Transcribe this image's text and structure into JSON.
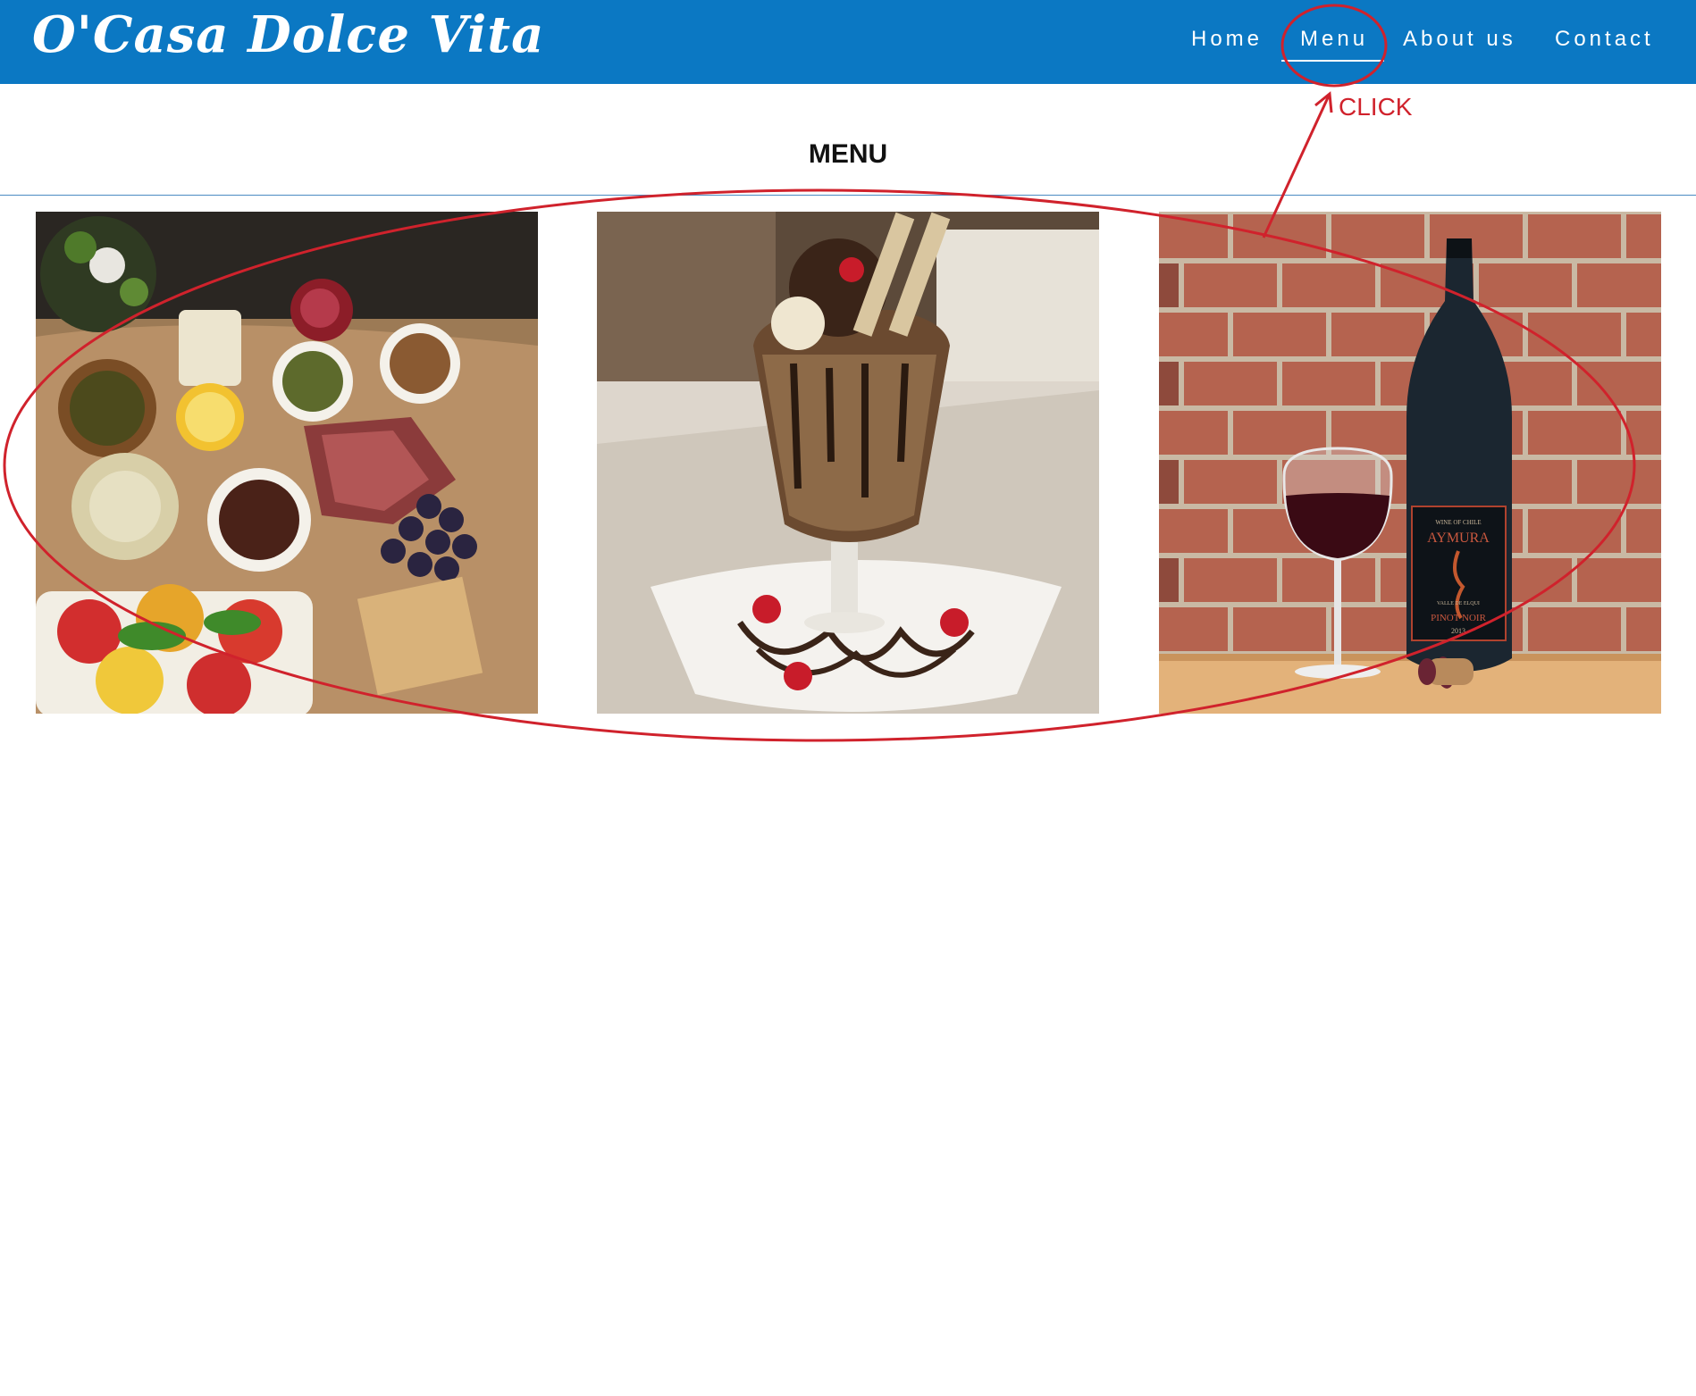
{
  "site": {
    "logo": "O'Casa Dolce Vita"
  },
  "nav": {
    "items": [
      {
        "label": "Home"
      },
      {
        "label": "Menu"
      },
      {
        "label": "About us"
      },
      {
        "label": "Contact"
      }
    ],
    "active": "Menu"
  },
  "main": {
    "title": "MENU"
  },
  "gallery": {
    "items": [
      {
        "subject": "antipasti board"
      },
      {
        "subject": "chocolate sundae"
      },
      {
        "subject": "red wine bottle and glass",
        "bottle_label": {
          "top": "WINE OF CHILE",
          "brand": "AYMURA",
          "region": "VALLE DE ELQUI",
          "variety": "PINOT NOIR",
          "year": "2013"
        }
      }
    ]
  },
  "annotation": {
    "label": "CLICK",
    "color": "#d0222c"
  },
  "colors": {
    "header_bg": "#0b78c3",
    "nav_text": "#ffffff",
    "title_text": "#111111"
  }
}
